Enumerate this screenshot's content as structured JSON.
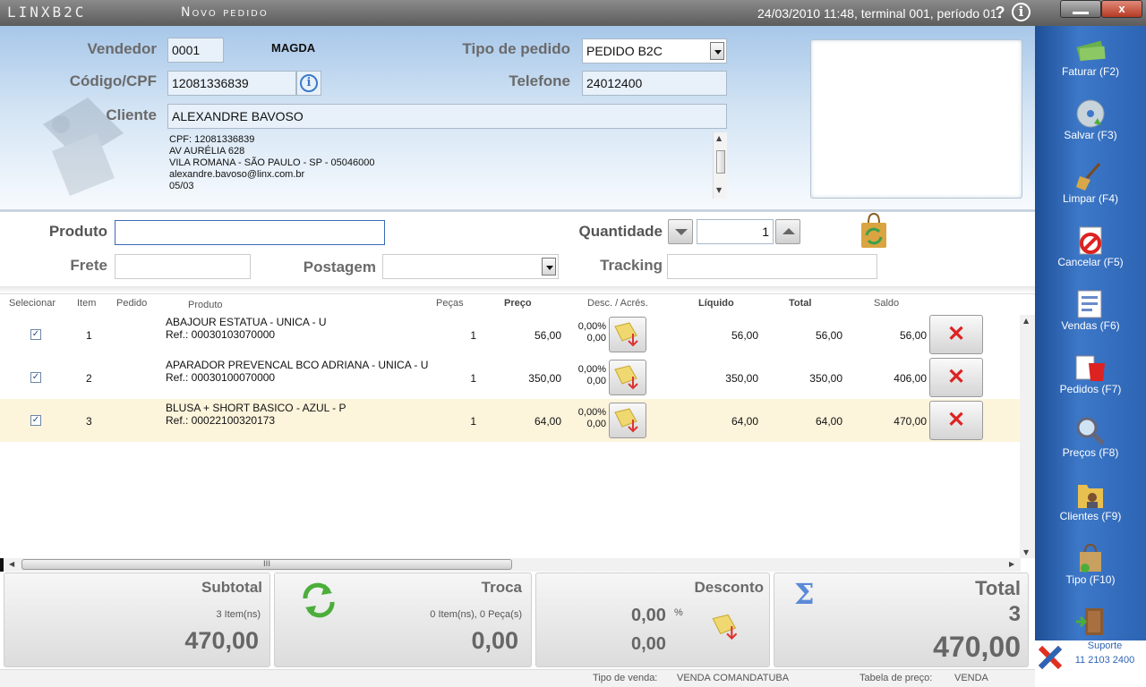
{
  "titlebar": {
    "brand": "LINXB2C",
    "window_title": "Novo pedido",
    "status": "24/03/2010 11:48, terminal 001, período 01.",
    "help_icon": "?",
    "info_icon": "i",
    "close_symbol": "x"
  },
  "header": {
    "vendedor_label": "Vendedor",
    "vendedor_code": "0001",
    "vendedor_name": "MAGDA",
    "codigo_label": "Código/CPF",
    "codigo_value": "12081336839",
    "cliente_label": "Cliente",
    "cliente_value": "ALEXANDRE BAVOSO",
    "tipo_label": "Tipo de pedido",
    "tipo_value": "PEDIDO B2C",
    "telefone_label": "Telefone",
    "telefone_value": "24012400",
    "address_lines": [
      "CPF: 12081336839",
      "AV AURÉLIA 628",
      "VILA ROMANA - SÃO PAULO - SP - 05046000",
      "alexandre.bavoso@linx.com.br",
      "05/03"
    ]
  },
  "product_entry": {
    "produto_label": "Produto",
    "produto_value": "",
    "quantidade_label": "Quantidade",
    "quantidade_value": "1",
    "frete_label": "Frete",
    "frete_value": "",
    "postagem_label": "Postagem",
    "postagem_value": "",
    "tracking_label": "Tracking",
    "tracking_value": ""
  },
  "grid": {
    "columns": [
      "Selecionar",
      "Item",
      "Pedido",
      "Produto",
      "Peças",
      "Preço",
      "Desc. / Acrés.",
      "Líquido",
      "Total",
      "Saldo"
    ],
    "rows": [
      {
        "item": "1",
        "name": "ABAJOUR ESTATUA - UNICA - U",
        "ref": "Ref.: 00030103070000",
        "pecas": "1",
        "preco": "56,00",
        "desc_pct": "0,00%",
        "desc_val": "0,00",
        "liquido": "56,00",
        "total": "56,00",
        "saldo": "56,00",
        "checked": "✓"
      },
      {
        "item": "2",
        "name": "APARADOR PREVENCAL BCO ADRIANA - UNICA - U",
        "ref": "Ref.: 00030100070000",
        "pecas": "1",
        "preco": "350,00",
        "desc_pct": "0,00%",
        "desc_val": "0,00",
        "liquido": "350,00",
        "total": "350,00",
        "saldo": "406,00",
        "checked": "✓"
      },
      {
        "item": "3",
        "name": "BLUSA + SHORT BASICO - AZUL - P",
        "ref": "Ref.: 00022100320173",
        "pecas": "1",
        "preco": "64,00",
        "desc_pct": "0,00%",
        "desc_val": "0,00",
        "liquido": "64,00",
        "total": "64,00",
        "saldo": "470,00",
        "checked": "✓"
      }
    ],
    "delete_symbol": "✕",
    "hscroll_grip": "III"
  },
  "summary": {
    "subtotal_label": "Subtotal",
    "subtotal_items": "3 Item(ns)",
    "subtotal_value": "470,00",
    "troca_label": "Troca",
    "troca_items": "0 Item(ns), 0 Peça(s)",
    "troca_value": "0,00",
    "desconto_label": "Desconto",
    "desconto_pct": "0,00",
    "desconto_pct_sign": "%",
    "desconto_value": "0,00",
    "total_label": "Total",
    "total_count": "3",
    "total_value": "470,00"
  },
  "statusbar": {
    "tipo_venda_label": "Tipo de venda:",
    "tipo_venda_value": "VENDA COMANDATUBA",
    "tabela_label": "Tabela de preço:",
    "tabela_value": "VENDA"
  },
  "sidebar": {
    "items": [
      {
        "label": "Faturar (F2)",
        "icon": "money-icon"
      },
      {
        "label": "Salvar (F3)",
        "icon": "disc-icon"
      },
      {
        "label": "Limpar (F4)",
        "icon": "broom-icon"
      },
      {
        "label": "Cancelar (F5)",
        "icon": "cancel-icon"
      },
      {
        "label": "Vendas (F6)",
        "icon": "sales-icon"
      },
      {
        "label": "Pedidos (F7)",
        "icon": "orders-icon"
      },
      {
        "label": "Preços (F8)",
        "icon": "magnifier-icon"
      },
      {
        "label": "Clientes (F9)",
        "icon": "clients-icon"
      },
      {
        "label": "Tipo (F10)",
        "icon": "bag-icon"
      }
    ],
    "support_label": "Suporte",
    "support_phone": "11 2103 2400"
  },
  "colors": {
    "accent_blue": "#2d64b4",
    "header_blue": "#a7c7e9",
    "delete_red": "#dd2222",
    "selected_row": "#fdf4dc"
  }
}
